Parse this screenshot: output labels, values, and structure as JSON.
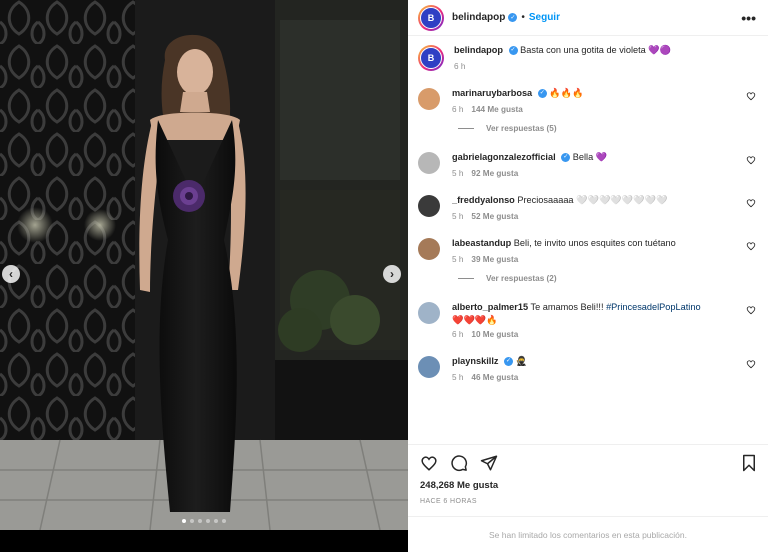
{
  "post": {
    "author": "belindapop",
    "follow_label": "Seguir",
    "separator": "•",
    "more_label": "•••",
    "avatar_initials": "B"
  },
  "caption": {
    "user": "belindapop",
    "text": "Basta con una gotita de violeta 💜🟣",
    "time": "6 h"
  },
  "comments": [
    {
      "user": "marinaruybarbosa",
      "verified": true,
      "text": "🔥🔥🔥",
      "time": "6 h",
      "likes": "144 Me gusta",
      "avatar_color": "#d89b6a",
      "replies": "Ver respuestas (5)"
    },
    {
      "user": "gabrielagonzalezofficial",
      "verified": true,
      "text": "Bella 💜",
      "time": "5 h",
      "likes": "92 Me gusta",
      "avatar_color": "#b7b7b7",
      "replies": ""
    },
    {
      "user": "_freddyalonso",
      "verified": false,
      "text": "Preciosaaaaa 🤍🤍🤍🤍🤍🤍🤍🤍",
      "time": "5 h",
      "likes": "52 Me gusta",
      "avatar_color": "#3a3a3a",
      "replies": ""
    },
    {
      "user": "labeastandup",
      "verified": false,
      "text": "Beli, te invito unos esquites con tuétano",
      "time": "5 h",
      "likes": "39 Me gusta",
      "avatar_color": "#a57a58",
      "replies": "Ver respuestas (2)"
    },
    {
      "user": "alberto_palmer15",
      "verified": false,
      "text": "Te amamos Beli!!!",
      "hashtag": "#PrincesadelPopLatino",
      "line2": "❤️❤️❤️🔥",
      "time": "6 h",
      "likes": "10 Me gusta",
      "avatar_color": "#9fb3c8",
      "replies": ""
    },
    {
      "user": "playnskillz",
      "verified": true,
      "text": "🥷",
      "time": "5 h",
      "likes": "46 Me gusta",
      "avatar_color": "#6c8fb5",
      "replies": ""
    }
  ],
  "actions": {
    "likes": "248,268 Me gusta",
    "time_ago": "HACE 6 HORAS",
    "limited": "Se han limitado los comentarios en esta publicación."
  },
  "icons": {
    "like": "heart-icon",
    "comment": "comment-icon",
    "share": "share-icon",
    "save": "bookmark-icon",
    "prev": "chevron-left-icon",
    "next": "chevron-right-icon"
  },
  "media": {
    "prev_glyph": "‹",
    "next_glyph": "›",
    "carousel_dots": 6,
    "active_dot": 0
  },
  "colors": {
    "link": "#0095f6",
    "verified": "#3897f0",
    "muted": "#8e8e8e"
  }
}
